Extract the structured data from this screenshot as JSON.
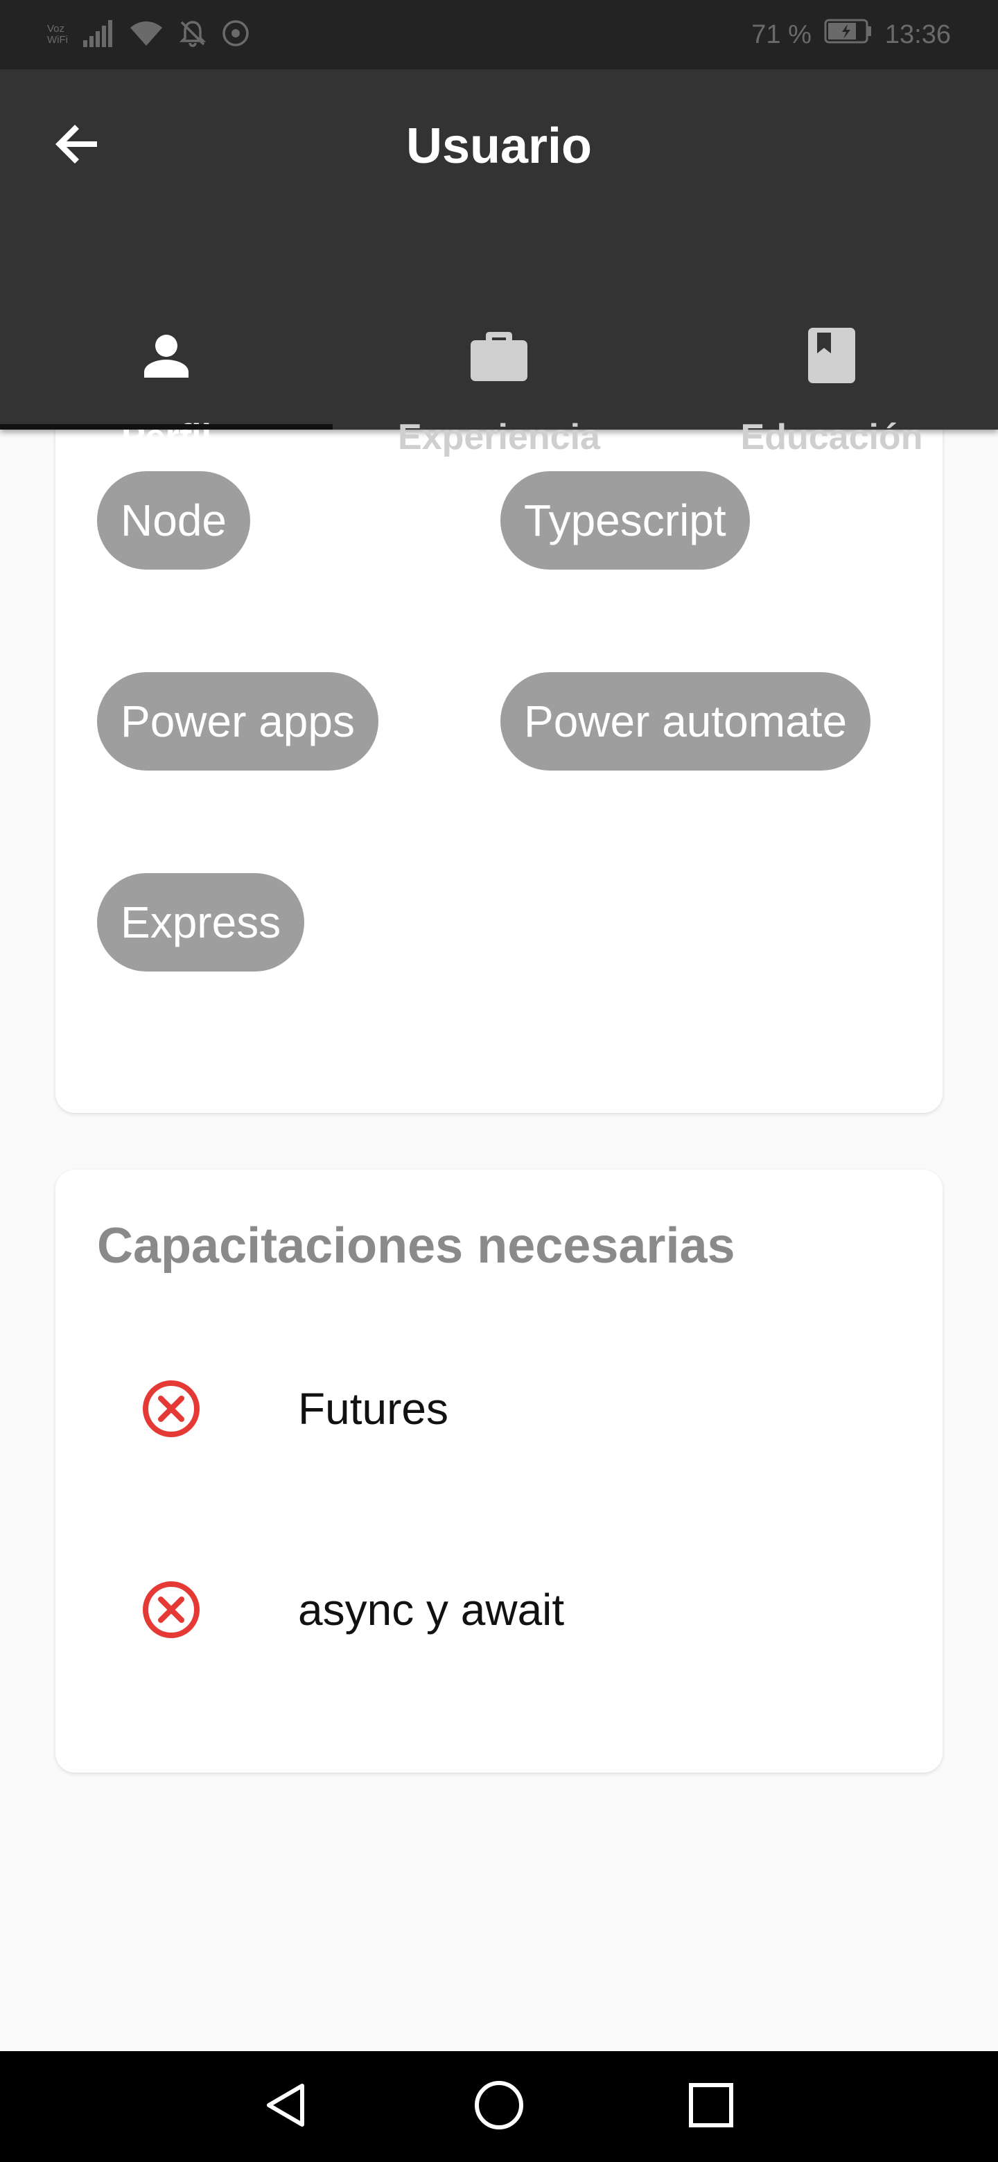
{
  "status_bar": {
    "network_line1": "Voz",
    "network_line2": "WiFi",
    "battery_percent": "71 %",
    "time": "13:36"
  },
  "app_bar": {
    "title": "Usuario",
    "back_icon": "arrow-back-icon"
  },
  "tabs": [
    {
      "label": "Perfil",
      "icon": "person-icon",
      "active": true
    },
    {
      "label": "Experiencia",
      "icon": "briefcase-icon",
      "active": false
    },
    {
      "label": "Educación",
      "icon": "book-icon",
      "active": false
    }
  ],
  "skills": {
    "chips": [
      "Node",
      "Typescript",
      "Power apps",
      "Power automate",
      "Express"
    ]
  },
  "training": {
    "title": "Capacitaciones necesarias",
    "items": [
      {
        "label": "Futures",
        "status_icon": "cancel-circle-icon"
      },
      {
        "label": "async y await",
        "status_icon": "cancel-circle-icon"
      }
    ]
  },
  "nav_bar": {
    "buttons": [
      "back-triangle-icon",
      "home-circle-icon",
      "recents-square-icon"
    ]
  },
  "colors": {
    "app_bar": "#333333",
    "chip": "#9e9e9e",
    "error_icon": "#e53935",
    "background": "#fafafa"
  }
}
